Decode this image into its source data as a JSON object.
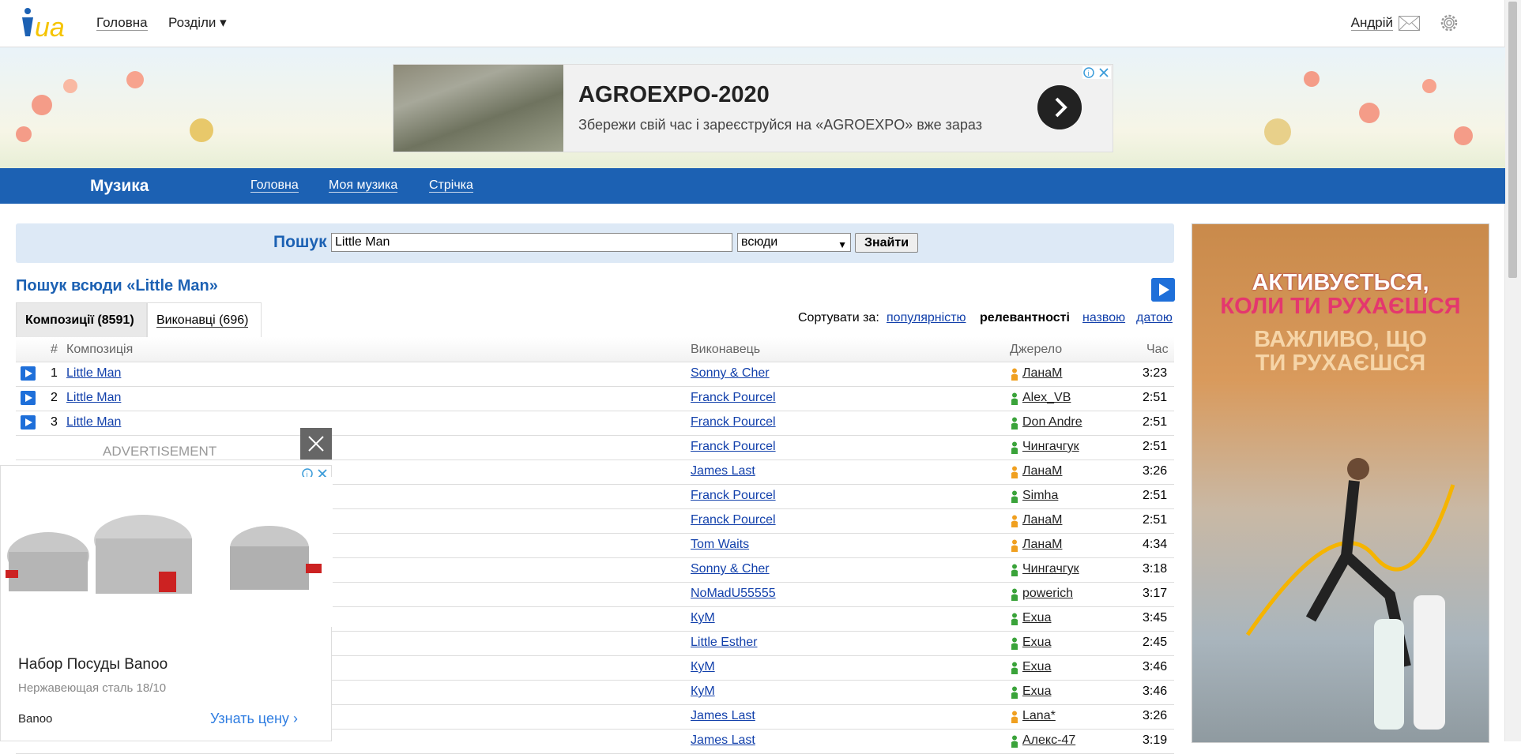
{
  "header": {
    "logo_text": "i.ua",
    "nav": [
      {
        "label": "Головна"
      },
      {
        "label": "Розділи ▾"
      }
    ],
    "user_name": "Андрій"
  },
  "top_ad": {
    "title": "AGROEXPO-2020",
    "subtitle": "Збережи свій час і зареєструйся на «AGROEXPO» вже зараз"
  },
  "music_nav": {
    "title": "Музика",
    "links": [
      {
        "label": "Головна"
      },
      {
        "label": "Моя музика"
      },
      {
        "label": "Стрічка"
      }
    ]
  },
  "search": {
    "label": "Пошук",
    "query": "Little Man",
    "scope": "всюди",
    "button": "Знайти"
  },
  "results": {
    "title": "Пошук всюди «Little Man»",
    "tabs": [
      {
        "label": "Композиції (8591)"
      },
      {
        "label": "Виконавці (696)"
      }
    ],
    "sort_label": "Сортувати за:",
    "sort_options": [
      {
        "label": "популярністю"
      },
      {
        "label": "релевантності"
      },
      {
        "label": "назвою"
      },
      {
        "label": "датою"
      }
    ],
    "columns": {
      "num": "#",
      "track": "Композиція",
      "artist": "Виконавець",
      "source": "Джерело",
      "time": "Час"
    },
    "rows": [
      {
        "num": "1",
        "track": "Little Man",
        "artist": "Sonny & Cher",
        "source": "ЛанаМ",
        "source_color": "#f0a020",
        "time": "3:23"
      },
      {
        "num": "2",
        "track": "Little Man",
        "artist": "Franck Pourcel",
        "source": "Alex_VB",
        "source_color": "#3aa33a",
        "time": "2:51"
      },
      {
        "num": "3",
        "track": "Little Man",
        "artist": "Franck Pourcel",
        "source": "Don Andre",
        "source_color": "#3aa33a",
        "time": "2:51"
      },
      {
        "num": "",
        "track": "",
        "artist": "Franck Pourcel",
        "source": "Чингачгук",
        "source_color": "#3aa33a",
        "time": "2:51"
      },
      {
        "num": "",
        "track": "",
        "artist": "James Last",
        "source": "ЛанаМ",
        "source_color": "#f0a020",
        "time": "3:26"
      },
      {
        "num": "",
        "track": "",
        "artist": "Franck Pourcel",
        "source": "Simha",
        "source_color": "#3aa33a",
        "time": "2:51"
      },
      {
        "num": "",
        "track": "",
        "artist": "Franck Pourcel",
        "source": "ЛанаМ",
        "source_color": "#f0a020",
        "time": "2:51"
      },
      {
        "num": "",
        "track": "",
        "artist": "Tom Waits",
        "source": "ЛанаМ",
        "source_color": "#f0a020",
        "time": "4:34"
      },
      {
        "num": "",
        "track": "",
        "artist": "Sonny & Cher",
        "source": "Чингачгук",
        "source_color": "#3aa33a",
        "time": "3:18"
      },
      {
        "num": "",
        "track": "",
        "artist": "NoMadU55555",
        "source": "powerich",
        "source_color": "#3aa33a",
        "time": "3:17"
      },
      {
        "num": "",
        "track": "",
        "artist": "КуМ",
        "source": "Exua",
        "source_color": "#3aa33a",
        "time": "3:45"
      },
      {
        "num": "",
        "track": "",
        "artist": "Little Esther",
        "source": "Exua",
        "source_color": "#3aa33a",
        "time": "2:45"
      },
      {
        "num": "",
        "track": "",
        "artist": "КуМ",
        "source": "Exua",
        "source_color": "#3aa33a",
        "time": "3:46"
      },
      {
        "num": "",
        "track": "",
        "artist": "КуМ",
        "source": "Exua",
        "source_color": "#3aa33a",
        "time": "3:46"
      },
      {
        "num": "",
        "track": "",
        "artist": "James Last",
        "source": "Lana*",
        "source_color": "#f0a020",
        "time": "3:26"
      },
      {
        "num": "",
        "track": "",
        "artist": "James Last",
        "source": "Алекс-47",
        "source_color": "#3aa33a",
        "time": "3:19"
      }
    ]
  },
  "side_ad": {
    "line1": "АКТИВУЄТЬСЯ,",
    "line2": "КОЛИ ТИ РУХАЄШСЯ",
    "line3": "ВАЖЛИВО, ЩО",
    "line4": "ТИ РУХАЄШСЯ"
  },
  "float_ad": {
    "label": "ADVERTISEMENT",
    "title": "Набор Посуды Banoo",
    "subtitle": "Нержавеющая сталь 18/10",
    "brand": "Banoo",
    "cta": "Узнать цену"
  }
}
